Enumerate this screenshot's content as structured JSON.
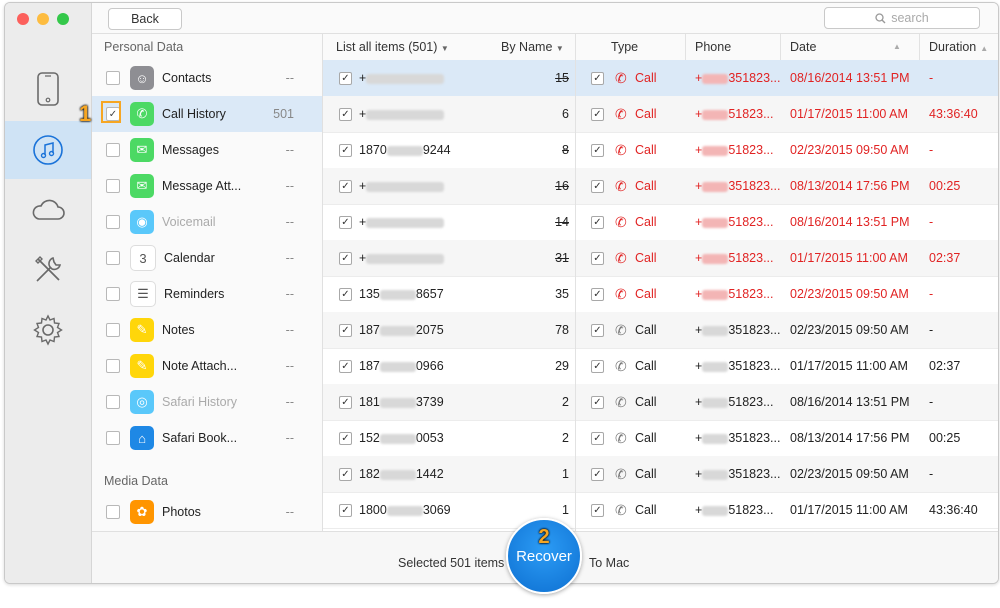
{
  "topbar": {
    "back_label": "Back",
    "search_placeholder": "search"
  },
  "sidebar": {
    "personal_title": "Personal Data",
    "media_title": "Media Data",
    "items": [
      {
        "label": "Contacts",
        "count": "--",
        "checked": false,
        "disabled": false,
        "icon": "contacts-icon",
        "color": "#8e8e93"
      },
      {
        "label": "Call History",
        "count": "501",
        "checked": true,
        "disabled": false,
        "icon": "phone-icon",
        "color": "#4cd964"
      },
      {
        "label": "Messages",
        "count": "--",
        "checked": false,
        "disabled": false,
        "icon": "messages-icon",
        "color": "#4cd964"
      },
      {
        "label": "Message Att...",
        "count": "--",
        "checked": false,
        "disabled": false,
        "icon": "attachment-icon",
        "color": "#4cd964"
      },
      {
        "label": "Voicemail",
        "count": "--",
        "checked": false,
        "disabled": true,
        "icon": "voicemail-icon",
        "color": "#5ac8fa"
      },
      {
        "label": "Calendar",
        "count": "--",
        "checked": false,
        "disabled": false,
        "icon": "calendar-icon",
        "color": "#ffffff"
      },
      {
        "label": "Reminders",
        "count": "--",
        "checked": false,
        "disabled": false,
        "icon": "reminders-icon",
        "color": "#ffffff"
      },
      {
        "label": "Notes",
        "count": "--",
        "checked": false,
        "disabled": false,
        "icon": "notes-icon",
        "color": "#ffd60a"
      },
      {
        "label": "Note Attach...",
        "count": "--",
        "checked": false,
        "disabled": false,
        "icon": "note-attachment-icon",
        "color": "#ffd60a"
      },
      {
        "label": "Safari History",
        "count": "--",
        "checked": false,
        "disabled": true,
        "icon": "safari-icon",
        "color": "#5ac8fa"
      },
      {
        "label": "Safari Book...",
        "count": "--",
        "checked": false,
        "disabled": false,
        "icon": "bookmark-icon",
        "color": "#1e88e5"
      }
    ],
    "media_items": [
      {
        "label": "Photos",
        "count": "--",
        "checked": false,
        "disabled": false,
        "icon": "photos-icon",
        "color": "#ff9500"
      }
    ]
  },
  "table": {
    "headers": {
      "list": "List all items (501)",
      "sort": "By Name",
      "type": "Type",
      "phone": "Phone",
      "date": "Date",
      "duration": "Duration"
    },
    "rows": [
      {
        "name_pre": "+",
        "name_post": "",
        "count": "15",
        "strike": true,
        "type": "Call",
        "missed": true,
        "phone": "351823...",
        "date": "08/16/2014 13:51 PM",
        "duration": "-"
      },
      {
        "name_pre": "+",
        "name_post": "",
        "count": "6",
        "strike": false,
        "type": "Call",
        "missed": true,
        "phone": "51823...",
        "date": "01/17/2015 11:00 AM",
        "duration": "43:36:40"
      },
      {
        "name_pre": "1870",
        "name_post": "9244",
        "count": "8",
        "strike": true,
        "type": "Call",
        "missed": true,
        "phone": "51823...",
        "date": "02/23/2015 09:50 AM",
        "duration": "-"
      },
      {
        "name_pre": "+",
        "name_post": "",
        "count": "16",
        "strike": true,
        "type": "Call",
        "missed": true,
        "phone": "351823...",
        "date": "08/13/2014 17:56 PM",
        "duration": "00:25"
      },
      {
        "name_pre": "+",
        "name_post": "",
        "count": "14",
        "strike": true,
        "type": "Call",
        "missed": true,
        "phone": "51823...",
        "date": "08/16/2014 13:51 PM",
        "duration": "-"
      },
      {
        "name_pre": "+",
        "name_post": "",
        "count": "31",
        "strike": true,
        "type": "Call",
        "missed": true,
        "phone": "51823...",
        "date": "01/17/2015 11:00 AM",
        "duration": "02:37"
      },
      {
        "name_pre": "135",
        "name_post": "8657",
        "count": "35",
        "strike": false,
        "type": "Call",
        "missed": true,
        "phone": "51823...",
        "date": "02/23/2015 09:50 AM",
        "duration": "-"
      },
      {
        "name_pre": "187",
        "name_post": "2075",
        "count": "78",
        "strike": false,
        "type": "Call",
        "missed": false,
        "phone": "351823...",
        "date": "02/23/2015 09:50 AM",
        "duration": "-"
      },
      {
        "name_pre": "187",
        "name_post": "0966",
        "count": "29",
        "strike": false,
        "type": "Call",
        "missed": false,
        "phone": "351823...",
        "date": "01/17/2015 11:00 AM",
        "duration": "02:37"
      },
      {
        "name_pre": "181",
        "name_post": "3739",
        "count": "2",
        "strike": false,
        "type": "Call",
        "missed": false,
        "phone": "51823...",
        "date": "08/16/2014 13:51 PM",
        "duration": "-"
      },
      {
        "name_pre": "152",
        "name_post": "0053",
        "count": "2",
        "strike": false,
        "type": "Call",
        "missed": false,
        "phone": "351823...",
        "date": "08/13/2014 17:56 PM",
        "duration": "00:25"
      },
      {
        "name_pre": "182",
        "name_post": "1442",
        "count": "1",
        "strike": false,
        "type": "Call",
        "missed": false,
        "phone": "351823...",
        "date": "02/23/2015 09:50 AM",
        "duration": "-"
      },
      {
        "name_pre": "1800",
        "name_post": "3069",
        "count": "1",
        "strike": false,
        "type": "Call",
        "missed": false,
        "phone": "51823...",
        "date": "01/17/2015 11:00 AM",
        "duration": "43:36:40"
      }
    ]
  },
  "bottom": {
    "selected": "Selected 501 items",
    "recover": "Recover",
    "to": "To Mac"
  },
  "annotations": {
    "step1": "1",
    "step2": "2"
  }
}
